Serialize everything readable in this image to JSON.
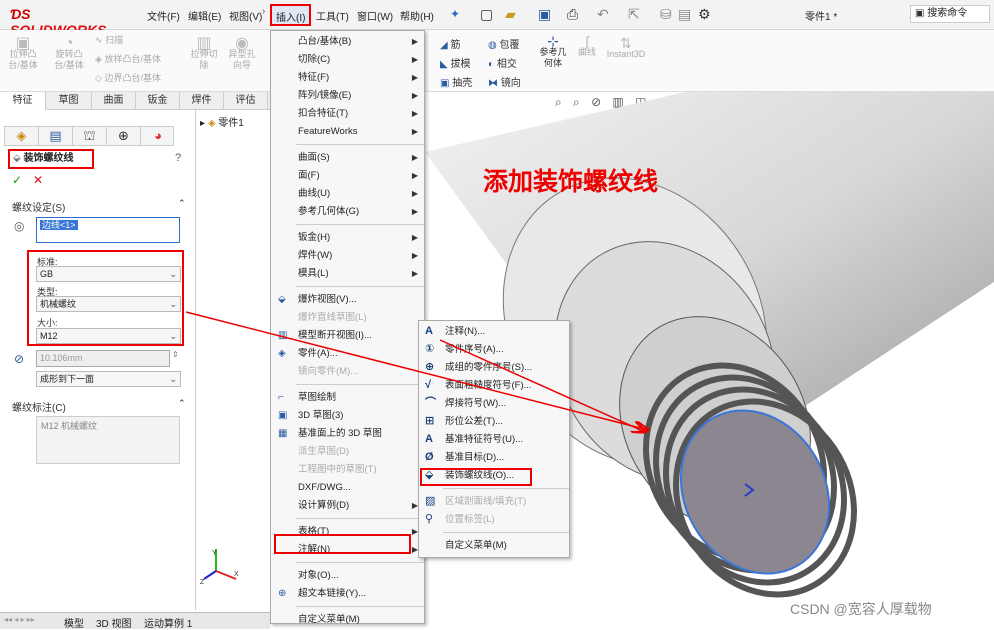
{
  "app": {
    "logo": "SOLIDWORKS",
    "doc_title": "零件1 *",
    "search": "搜索命令"
  },
  "menubar": [
    {
      "label": "文件(F)"
    },
    {
      "label": "编辑(E)"
    },
    {
      "label": "视图(V)"
    },
    {
      "label": "插入(I)"
    },
    {
      "label": "工具(T)"
    },
    {
      "label": "窗口(W)"
    },
    {
      "label": "帮助(H)"
    }
  ],
  "ribbon": {
    "left": [
      "拉伸凸\n台/基体",
      "旋转凸\n台/基体",
      "拉伸切\n除",
      "异型孔\n向导"
    ],
    "small": [
      "扫描",
      "放样凸台/基体",
      "边界凸台/基体"
    ],
    "right": [
      "筋",
      "包覆",
      "拔模",
      "相交",
      "抽壳",
      "镜向"
    ],
    "ref_geom": "参考几\n何体",
    "curves": "曲线",
    "instant3d": "Instant3D"
  },
  "tabs": [
    "特征",
    "草图",
    "曲面",
    "钣金",
    "焊件",
    "评估"
  ],
  "tree": {
    "root": "零件1"
  },
  "panel": {
    "title": "装饰螺纹线",
    "thread_settings": "螺纹设定(S)",
    "edge": "边线<1>",
    "standard_label": "标准:",
    "standard": "GB",
    "type_label": "类型:",
    "type": "机械螺纹",
    "size_label": "大小:",
    "size": "M12",
    "depth": "10.106mm",
    "end": "成形到下一面",
    "callout_section": "螺纹标注(C)",
    "callout": "M12 机械螺纹"
  },
  "insert_menu": [
    {
      "label": "凸台/基体(B)",
      "arrow": true
    },
    {
      "label": "切除(C)",
      "arrow": true
    },
    {
      "label": "特征(F)",
      "arrow": true
    },
    {
      "label": "阵列/镜像(E)",
      "arrow": true
    },
    {
      "label": "扣合特征(T)",
      "arrow": true
    },
    {
      "label": "FeatureWorks",
      "arrow": true
    },
    {
      "sep": true
    },
    {
      "label": "曲面(S)",
      "arrow": true
    },
    {
      "label": "面(F)",
      "arrow": true
    },
    {
      "label": "曲线(U)",
      "arrow": true
    },
    {
      "label": "参考几何体(G)",
      "arrow": true
    },
    {
      "sep": true
    },
    {
      "label": "钣金(H)",
      "arrow": true
    },
    {
      "label": "焊件(W)",
      "arrow": true
    },
    {
      "label": "模具(L)",
      "arrow": true
    },
    {
      "sep": true
    },
    {
      "label": "爆炸视图(V)...",
      "icon": "explode"
    },
    {
      "label": "爆炸直线草图(L)",
      "dis": true
    },
    {
      "label": "模型断开视图(I)...",
      "icon": "break"
    },
    {
      "label": "零件(A)...",
      "icon": "part"
    },
    {
      "label": "镜向零件(M)...",
      "dis": true
    },
    {
      "sep": true
    },
    {
      "label": "草图绘制",
      "icon": "sketch"
    },
    {
      "label": "3D 草图(3)",
      "icon": "3d"
    },
    {
      "label": "基准面上的 3D 草图",
      "icon": "plane3d"
    },
    {
      "label": "派生草图(D)",
      "dis": true
    },
    {
      "label": "工程图中的草图(T)",
      "dis": true
    },
    {
      "label": "DXF/DWG..."
    },
    {
      "label": "设计算例(D)",
      "arrow": true
    },
    {
      "sep": true
    },
    {
      "label": "表格(T)",
      "arrow": true
    },
    {
      "label": "注解(N)",
      "arrow": true
    },
    {
      "sep": true
    },
    {
      "label": "对象(O)..."
    },
    {
      "label": "超文本链接(Y)...",
      "icon": "link"
    },
    {
      "sep": true
    },
    {
      "label": "自定义菜单(M)"
    }
  ],
  "annotation_submenu": [
    {
      "label": "注释(N)...",
      "icon": "A"
    },
    {
      "label": "零件序号(A)...",
      "icon": "①"
    },
    {
      "label": "成组的零件序号(S)...",
      "icon": "⊕"
    },
    {
      "label": "表面粗糙度符号(F)...",
      "icon": "√"
    },
    {
      "label": "焊接符号(W)...",
      "icon": "⌒"
    },
    {
      "label": "形位公差(T)...",
      "icon": "⊞"
    },
    {
      "label": "基准特征符号(U)...",
      "icon": "A"
    },
    {
      "label": "基准目标(D)...",
      "icon": "Ø"
    },
    {
      "label": "装饰螺纹线(O)...",
      "icon": "⬙"
    },
    {
      "sep": true
    },
    {
      "label": "区域剖面线/填充(T)",
      "dis": true,
      "icon": "▨"
    },
    {
      "label": "位置标签(L)",
      "dis": true,
      "icon": "⚲"
    },
    {
      "sep": true
    },
    {
      "label": "自定义菜单(M)"
    }
  ],
  "callout_text": "添加装饰螺纹线",
  "bottom_tabs": [
    "模型",
    "3D 视图",
    "运动算例 1"
  ],
  "watermark": "CSDN @宽容人厚载物",
  "colors": {
    "red": "#e00000",
    "brand": "#d11111",
    "selection": "#3a76d9"
  }
}
